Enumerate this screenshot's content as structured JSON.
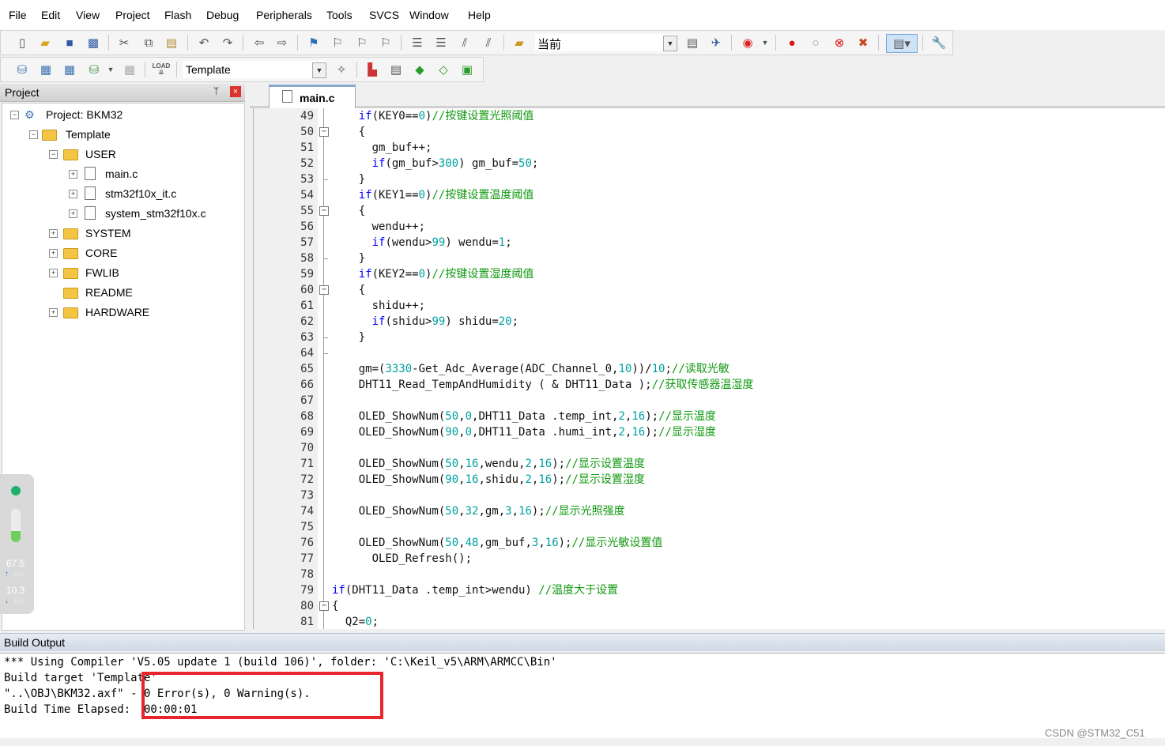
{
  "menu": [
    "File",
    "Edit",
    "View",
    "Project",
    "Flash",
    "Debug",
    "Peripherals",
    "Tools",
    "SVCS",
    "Window",
    "Help"
  ],
  "toolbar": {
    "find_combo_value": "当前",
    "target_combo_value": "Template",
    "load_label": "LOAD"
  },
  "project_panel": {
    "title": "Project",
    "pin_glyph": "ᛘ",
    "close_glyph": "×",
    "tree": {
      "root": "Project: BKM32",
      "target": "Template",
      "user_group": "USER",
      "files": [
        "main.c",
        "stm32f10x_it.c",
        "system_stm32f10x.c"
      ],
      "groups": [
        "SYSTEM",
        "CORE",
        "FWLIB",
        "README",
        "HARDWARE"
      ]
    }
  },
  "net_widget": {
    "upload": "67.5",
    "upload_unit": "K/s",
    "download": "10.3",
    "download_unit": "K/s"
  },
  "editor": {
    "tab": "main.c",
    "lines": [
      {
        "n": "49",
        "t": "    if(KEY0==0)//按键设置光照阈值"
      },
      {
        "n": "50",
        "t": "    {"
      },
      {
        "n": "51",
        "t": "      gm_buf++;"
      },
      {
        "n": "52",
        "t": "      if(gm_buf>300) gm_buf=50;"
      },
      {
        "n": "53",
        "t": "    }"
      },
      {
        "n": "54",
        "t": "    if(KEY1==0)//按键设置温度阈值"
      },
      {
        "n": "55",
        "t": "    {"
      },
      {
        "n": "56",
        "t": "      wendu++;"
      },
      {
        "n": "57",
        "t": "      if(wendu>99) wendu=1;"
      },
      {
        "n": "58",
        "t": "    }"
      },
      {
        "n": "59",
        "t": "    if(KEY2==0)//按键设置湿度阈值"
      },
      {
        "n": "60",
        "t": "    {"
      },
      {
        "n": "61",
        "t": "      shidu++;"
      },
      {
        "n": "62",
        "t": "      if(shidu>99) shidu=20;"
      },
      {
        "n": "63",
        "t": "    }"
      },
      {
        "n": "64",
        "t": ""
      },
      {
        "n": "65",
        "t": "    gm=(3330-Get_Adc_Average(ADC_Channel_0,10))/10;//读取光敏"
      },
      {
        "n": "66",
        "t": "    DHT11_Read_TempAndHumidity ( & DHT11_Data );//获取传感器温湿度"
      },
      {
        "n": "67",
        "t": ""
      },
      {
        "n": "68",
        "t": "    OLED_ShowNum(50,0,DHT11_Data .temp_int,2,16);//显示温度"
      },
      {
        "n": "69",
        "t": "    OLED_ShowNum(90,0,DHT11_Data .humi_int,2,16);//显示湿度"
      },
      {
        "n": "70",
        "t": ""
      },
      {
        "n": "71",
        "t": "    OLED_ShowNum(50,16,wendu,2,16);//显示设置温度"
      },
      {
        "n": "72",
        "t": "    OLED_ShowNum(90,16,shidu,2,16);//显示设置湿度"
      },
      {
        "n": "73",
        "t": ""
      },
      {
        "n": "74",
        "t": "    OLED_ShowNum(50,32,gm,3,16);//显示光照强度"
      },
      {
        "n": "75",
        "t": ""
      },
      {
        "n": "76",
        "t": "    OLED_ShowNum(50,48,gm_buf,3,16);//显示光敏设置值"
      },
      {
        "n": "77",
        "t": "      OLED_Refresh();"
      },
      {
        "n": "78",
        "t": ""
      },
      {
        "n": "79",
        "t": "if(DHT11_Data .temp_int>wendu) //温度大于设置"
      },
      {
        "n": "80",
        "t": "{"
      },
      {
        "n": "81",
        "t": "  Q2=0;"
      }
    ]
  },
  "build_output": {
    "title": "Build Output",
    "lines": [
      "*** Using Compiler 'V5.05 update 1 (build 106)', folder: 'C:\\Keil_v5\\ARM\\ARMCC\\Bin'",
      "Build target 'Template'",
      "\"..\\OBJ\\BKM32.axf\" - 0 Error(s), 0 Warning(s).",
      "Build Time Elapsed:  00:00:01"
    ]
  },
  "watermark": "CSDN @STM32_C51",
  "colors": {
    "keyword": "#0000ff",
    "number": "#00a0a0",
    "comment": "#119911",
    "highlight_box": "#e8242c"
  }
}
